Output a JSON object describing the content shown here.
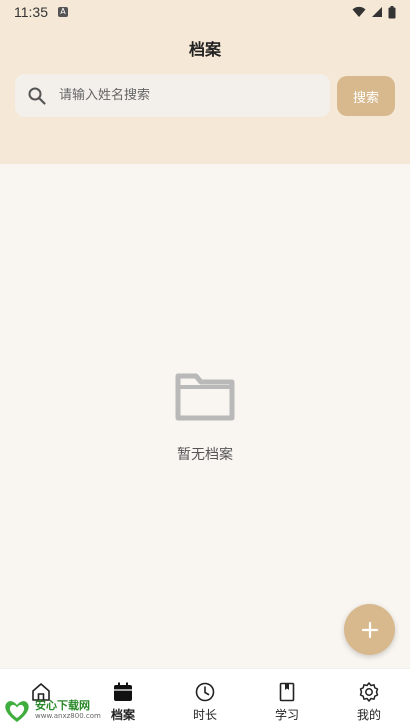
{
  "status_bar": {
    "time": "11:35"
  },
  "header": {
    "title": "档案"
  },
  "search": {
    "placeholder": "请输入姓名搜索",
    "button_label": "搜索"
  },
  "empty_state": {
    "text": "暂无档案"
  },
  "fab": {
    "icon": "plus-icon"
  },
  "bottom_nav": {
    "items": [
      {
        "label": "",
        "icon": "home-icon",
        "active": false
      },
      {
        "label": "档案",
        "icon": "calendar-icon",
        "active": true
      },
      {
        "label": "时长",
        "icon": "clock-icon",
        "active": false
      },
      {
        "label": "学习",
        "icon": "book-icon",
        "active": false
      },
      {
        "label": "我的",
        "icon": "gear-icon",
        "active": false
      }
    ]
  },
  "watermark": {
    "name": "安心下载网",
    "url": "www.anxz800.com"
  },
  "colors": {
    "header_bg": "#f5e8d6",
    "accent": "#d8b98d",
    "page_bg": "#f9f5f1"
  }
}
